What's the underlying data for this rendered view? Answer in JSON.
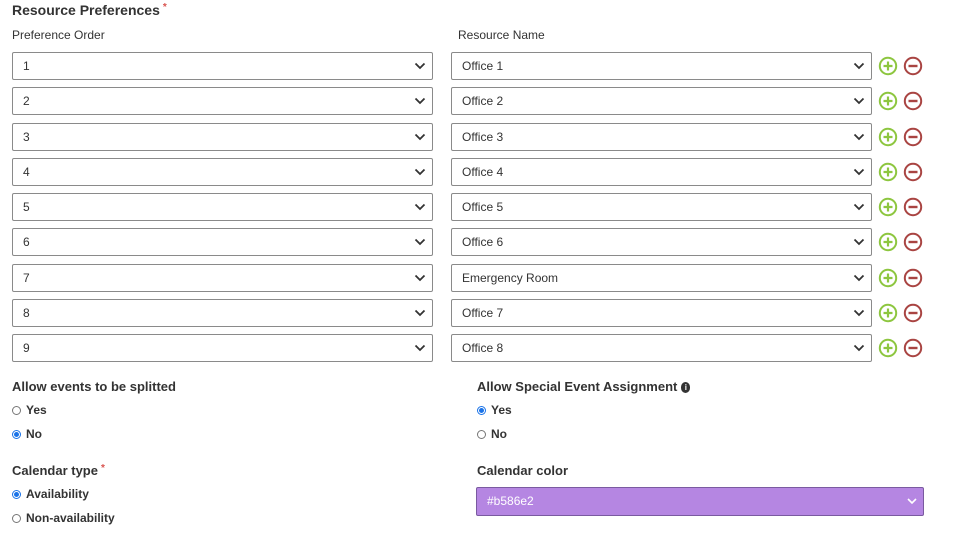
{
  "resource_preferences": {
    "title": "Resource Preferences",
    "required_mark": "*",
    "order_label": "Preference Order",
    "name_label": "Resource Name",
    "rows": [
      {
        "order": "1",
        "name": "Office 1"
      },
      {
        "order": "2",
        "name": "Office 2"
      },
      {
        "order": "3",
        "name": "Office 3"
      },
      {
        "order": "4",
        "name": "Office 4"
      },
      {
        "order": "5",
        "name": "Office 5"
      },
      {
        "order": "6",
        "name": "Office 6"
      },
      {
        "order": "7",
        "name": "Emergency Room"
      },
      {
        "order": "8",
        "name": "Office 7"
      },
      {
        "order": "9",
        "name": "Office 8"
      }
    ]
  },
  "split_events": {
    "label": "Allow events to be splitted",
    "options": [
      {
        "label": "Yes",
        "checked": false
      },
      {
        "label": "No",
        "checked": true
      }
    ]
  },
  "special_event": {
    "label": "Allow Special Event Assignment",
    "info_icon": "info-icon",
    "options": [
      {
        "label": "Yes",
        "checked": true
      },
      {
        "label": "No",
        "checked": false
      }
    ]
  },
  "calendar_type": {
    "label": "Calendar type",
    "required_mark": "*",
    "options": [
      {
        "label": "Availability",
        "checked": true
      },
      {
        "label": "Non-availability",
        "checked": false
      }
    ]
  },
  "calendar_color": {
    "label": "Calendar color",
    "value": "#b586e2",
    "swatch": "#b586e2"
  },
  "colors": {
    "add_icon": "#8dc63f",
    "remove_icon": "#a94442",
    "radio_accent": "#1a73e8",
    "required": "#d9534f"
  }
}
